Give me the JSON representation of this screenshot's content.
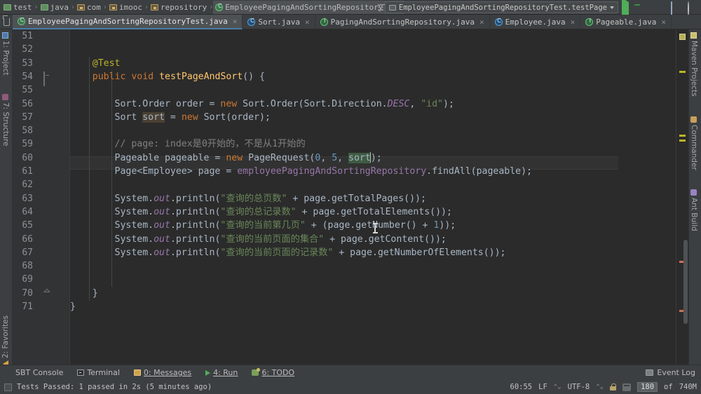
{
  "navbar": {
    "breadcrumbs": [
      {
        "label": "test",
        "icon": "folder-icon"
      },
      {
        "label": "java",
        "icon": "folder-icon"
      },
      {
        "label": "com",
        "icon": "package-icon"
      },
      {
        "label": "imooc",
        "icon": "package-icon"
      },
      {
        "label": "repository",
        "icon": "package-icon"
      },
      {
        "label": "EmployeePagingAndSortingRepositoryTest",
        "icon": "test-class-icon"
      }
    ],
    "separator": "›",
    "run_config": "EmployeePagingAndSortingRepositoryTest.testPage",
    "toolbar_icons": [
      "run-icon",
      "debug-icon",
      "run-with-coverage-icon",
      "profile-icon",
      "search-everywhere-icon"
    ]
  },
  "tabs": [
    {
      "label": "EmployeePagingAndSortingRepositoryTest.java",
      "icon": "test-class-icon",
      "active": true,
      "close": "×"
    },
    {
      "label": "Sort.java",
      "icon": "class-icon",
      "active": false,
      "close": "×"
    },
    {
      "label": "PagingAndSortingRepository.java",
      "icon": "interface-icon",
      "active": false,
      "close": "×"
    },
    {
      "label": "Employee.java",
      "icon": "class-icon",
      "active": false,
      "close": "×"
    },
    {
      "label": "Pageable.java",
      "icon": "interface-icon",
      "active": false,
      "close": "×"
    }
  ],
  "left_tool_tabs": [
    {
      "label": "1: Project",
      "icon": "project-icon"
    },
    {
      "label": "7: Structure",
      "icon": "structure-icon"
    },
    {
      "label": "2: Favorites",
      "icon": "favorites-icon"
    }
  ],
  "right_tool_tabs": [
    {
      "label": "Maven Projects",
      "icon": "maven-icon"
    },
    {
      "label": "Commander",
      "icon": "commander-icon"
    },
    {
      "label": "Ant Build",
      "icon": "ant-icon"
    }
  ],
  "editor": {
    "first_line": 51,
    "last_line": 71,
    "current_line": 60,
    "lines": [
      {
        "no": 51,
        "text": ""
      },
      {
        "no": 52,
        "text": ""
      },
      {
        "no": 53,
        "text": "    @Test"
      },
      {
        "no": 54,
        "text": "    public void testPageAndSort() {"
      },
      {
        "no": 55,
        "text": ""
      },
      {
        "no": 56,
        "text": "        Sort.Order order = new Sort.Order(Sort.Direction.DESC, \"id\");"
      },
      {
        "no": 57,
        "text": "        Sort sort = new Sort(order);"
      },
      {
        "no": 58,
        "text": ""
      },
      {
        "no": 59,
        "text": "        // page: index是0开始的，不是从1开始的"
      },
      {
        "no": 60,
        "text": "        Pageable pageable = new PageRequest(0, 5, sort);"
      },
      {
        "no": 61,
        "text": "        Page<Employee> page = employeePagingAndSortingRepository.findAll(pageable);"
      },
      {
        "no": 62,
        "text": ""
      },
      {
        "no": 63,
        "text": "        System.out.println(\"查询的总页数\" + page.getTotalPages());"
      },
      {
        "no": 64,
        "text": "        System.out.println(\"查询的总记录数\" + page.getTotalElements());"
      },
      {
        "no": 65,
        "text": "        System.out.println(\"查询的当前第几页\" + (page.getNumber() + 1));"
      },
      {
        "no": 66,
        "text": "        System.out.println(\"查询的当前页面的集合\" + page.getContent());"
      },
      {
        "no": 67,
        "text": "        System.out.println(\"查询的当前页面的记录数\" + page.getNumberOfElements());"
      },
      {
        "no": 68,
        "text": ""
      },
      {
        "no": 69,
        "text": ""
      },
      {
        "no": 70,
        "text": "    }"
      },
      {
        "no": 71,
        "text": "}"
      }
    ],
    "selection": "sort",
    "gutter_markers": [
      {
        "line": 54,
        "type": "run-test-icon"
      },
      {
        "line": 70,
        "type": "fold-icon"
      }
    ]
  },
  "bottom_bar": {
    "items": [
      {
        "label": "SBT Console",
        "icon": null
      },
      {
        "label": "Terminal",
        "icon": "terminal-icon"
      },
      {
        "label": "0: Messages",
        "icon": "messages-icon",
        "mnemonic": "0"
      },
      {
        "label": "4: Run",
        "icon": "run-icon",
        "mnemonic": "4"
      },
      {
        "label": "6: TODO",
        "icon": "todo-icon",
        "mnemonic": "6"
      }
    ],
    "event_log": "Event Log",
    "event_log_icon": "event-log-icon"
  },
  "status_bar": {
    "message": "Tests Passed: 1 passed in 2s (5 minutes ago)",
    "caret_position": "60:55",
    "line_separator": "LF",
    "encoding": "UTF-8",
    "lock_icon": "read-only-lock-icon",
    "hammer_icon": "hammer-icon",
    "memory_used": "180",
    "memory_of": "of",
    "memory_total": "740M"
  },
  "colors": {
    "background": "#2b2b2b",
    "chrome": "#3c3f41",
    "gutter": "#313335",
    "keyword": "#cc7832",
    "string": "#6a8759",
    "number": "#6897bb",
    "comment": "#808080",
    "annotation": "#bbb529",
    "field": "#9876aa",
    "selection": "#3e5c43",
    "accent_green": "#4fae5a"
  }
}
